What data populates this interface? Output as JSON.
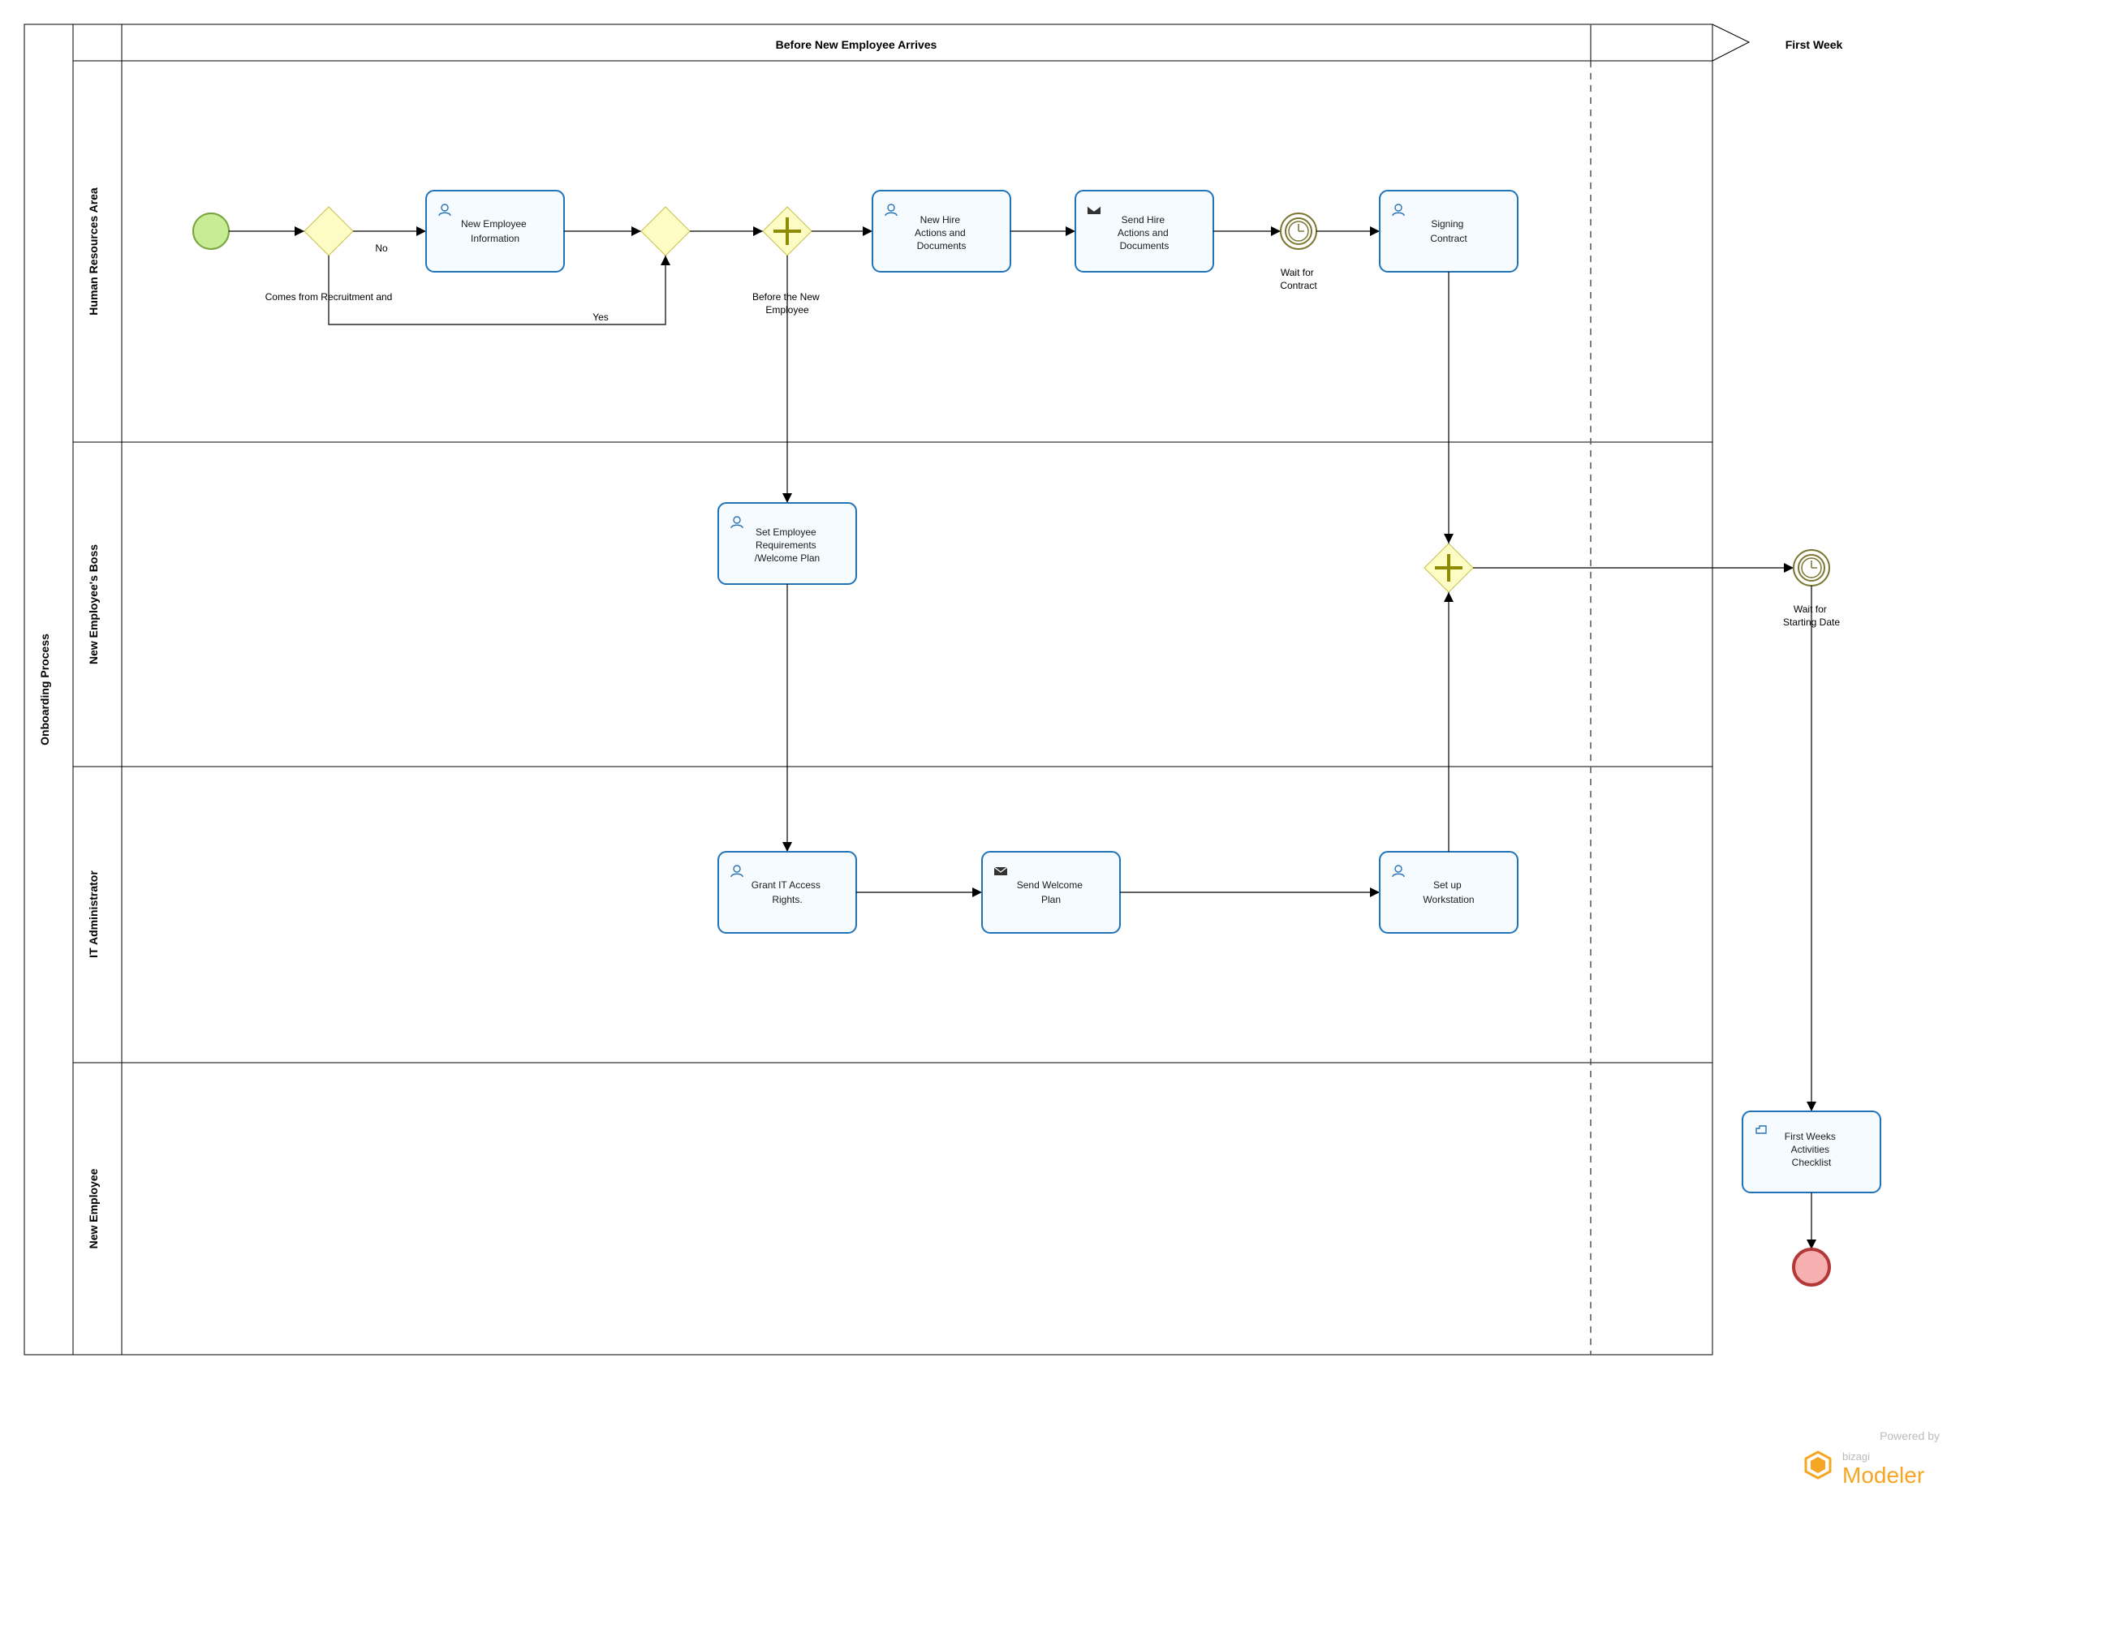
{
  "pool": {
    "title": "Onboarding Process"
  },
  "lanes": [
    {
      "id": "hr",
      "title": "Human Resources Area"
    },
    {
      "id": "boss",
      "title": "New Employee's Boss"
    },
    {
      "id": "it",
      "title": "IT Administrator"
    },
    {
      "id": "emp",
      "title": "New Employee"
    }
  ],
  "phases": [
    {
      "id": "before",
      "title": "Before New Employee Arrives"
    },
    {
      "id": "first",
      "title": "First Week"
    }
  ],
  "tasks": {
    "new_emp_info": {
      "text": "New Employee Information",
      "type": "user"
    },
    "new_hire_docs": {
      "text": "New Hire Actions and Documents",
      "type": "user"
    },
    "send_hire_docs": {
      "text": "Send Hire Actions and Documents",
      "type": "send"
    },
    "signing": {
      "text": "Signing Contract",
      "type": "user"
    },
    "set_reqs": {
      "text": "Set Employee Requirements /Welcome Plan",
      "type": "user"
    },
    "grant_it": {
      "text": "Grant IT Access Rights.",
      "type": "user"
    },
    "send_plan": {
      "text": "Send Welcome Plan",
      "type": "send"
    },
    "setup_ws": {
      "text": "Set up Workstation",
      "type": "user"
    },
    "checklist": {
      "text": "First Weeks Activities Checklist",
      "type": "manual"
    }
  },
  "gateways": {
    "g1": {
      "label": "Comes from Recruitment and"
    },
    "g2": {
      "label": ""
    },
    "parallel1": {
      "label": "Before the New Employee"
    },
    "parallel2": {
      "label": ""
    }
  },
  "flows": {
    "g1_no": "No",
    "g2_yes": "Yes"
  },
  "timers": {
    "wait_contract": "Wait for Contract",
    "wait_start": "Wait for Starting Date"
  },
  "footer": {
    "powered": "Powered by",
    "brand_small": "bizagi",
    "brand": "Modeler"
  }
}
